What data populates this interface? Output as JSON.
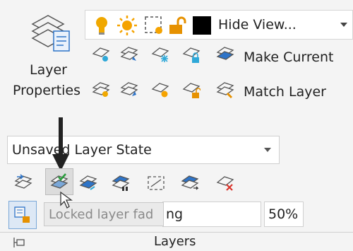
{
  "panel": {
    "title": "Layers",
    "layer_properties": {
      "line1": "Layer",
      "line2": "Properties"
    }
  },
  "layer_dropdown": {
    "value": "Hide View..."
  },
  "buttons": {
    "make_current": "Make Current",
    "match_layer": "Match Layer"
  },
  "layer_state": {
    "value": "Unsaved Layer State"
  },
  "tooltip": {
    "text": "Locked layer fad"
  },
  "locked_fading": {
    "partial_label": "ng",
    "value": "50%"
  },
  "colors": {
    "bulb": "#f0a800",
    "sun": "#f5a300",
    "lock": "#e69100",
    "layer_stroke": "#555555",
    "layer_blue": "#2e74c8",
    "cursor_arrow": "#333333",
    "delete_red": "#d9342b",
    "check_green": "#2a9d3c"
  }
}
